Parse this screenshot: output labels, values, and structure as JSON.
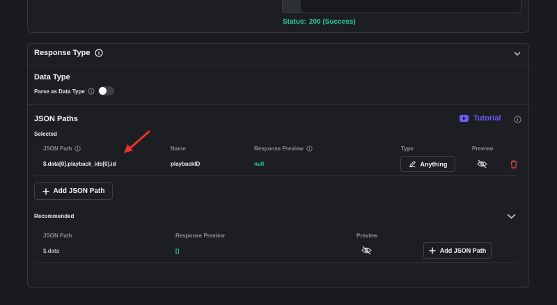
{
  "request": {
    "status_label": "Status:",
    "status_value": "200 (Success)"
  },
  "response_type": {
    "title": "Response Type"
  },
  "data_type": {
    "title": "Data Type",
    "parse_label": "Parse as Data Type",
    "parse_enabled": false
  },
  "json_paths": {
    "title": "JSON Paths",
    "tutorial_label": "Tutorial",
    "selected_title": "Selected",
    "columns": {
      "path": "JSON Path",
      "name": "Name",
      "preview": "Response Preview",
      "type": "Type",
      "preview_toggle": "Preview"
    },
    "rows": [
      {
        "path": "$.data[0].playback_ids[0].id",
        "name": "playbackID",
        "preview": "null",
        "type": "Anything"
      }
    ],
    "add_button": "Add JSON Path"
  },
  "recommended": {
    "title": "Recommended",
    "columns": {
      "path": "JSON Path",
      "preview": "Response Preview",
      "preview_toggle": "Preview"
    },
    "rows": [
      {
        "path": "$.data",
        "preview": "[]",
        "add_button": "Add JSON Path"
      }
    ]
  },
  "colors": {
    "accent_green": "#2fc9a2",
    "tutorial_purple": "#6a5cf5",
    "delete_red": "#e5484d",
    "arrow_red": "#e8322b"
  }
}
